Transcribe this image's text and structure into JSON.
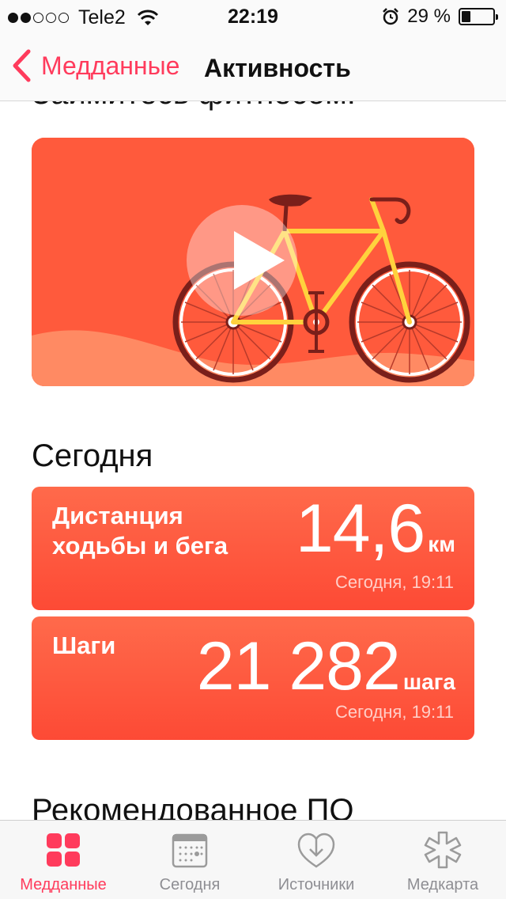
{
  "status_bar": {
    "carrier": "Tele2",
    "time": "22:19",
    "battery_text": "29 %",
    "battery_level": 0.29
  },
  "nav": {
    "back_label": "Медданные",
    "title": "Активность"
  },
  "content": {
    "partial_heading": "Займитесь фитнесом.",
    "today_title": "Сегодня",
    "recommended_title": "Рекомендованное ПО",
    "metrics": [
      {
        "label_line1": "Дистанция",
        "label_line2": "ходьбы и бега",
        "value": "14,6",
        "unit": "км",
        "time": "Сегодня, 19:11"
      },
      {
        "label_line1": "Шаги",
        "label_line2": "",
        "value": "21 282",
        "unit": "шага",
        "time": "Сегодня, 19:11"
      }
    ]
  },
  "tabbar": {
    "tabs": [
      {
        "label": "Медданные",
        "icon": "grid-icon",
        "active": true
      },
      {
        "label": "Сегодня",
        "icon": "calendar-icon",
        "active": false
      },
      {
        "label": "Источники",
        "icon": "download-heart-icon",
        "active": false
      },
      {
        "label": "Медкарта",
        "icon": "asterisk-icon",
        "active": false
      }
    ]
  },
  "colors": {
    "accent": "#ff3b5c",
    "card": "#fd5a3c"
  }
}
